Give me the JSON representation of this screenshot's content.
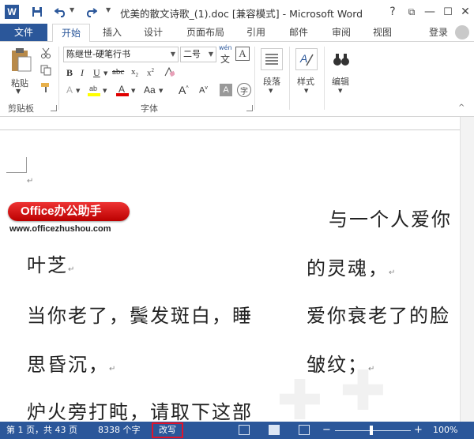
{
  "titlebar": {
    "app_logo": "W",
    "title": "优美的散文诗歌_(1).doc [兼容模式] - Microsoft Word",
    "help": "?",
    "restore": "⧉",
    "minimize": "—",
    "maximize": "☐",
    "close": "✕"
  },
  "tabs": {
    "file": "文件",
    "items": [
      "开始",
      "插入",
      "设计",
      "页面布局",
      "引用",
      "邮件",
      "审阅",
      "视图"
    ],
    "active_index": 0,
    "login": "登录"
  },
  "ribbon": {
    "clipboard": {
      "paste": "粘贴",
      "group": "剪贴板"
    },
    "font": {
      "family": "陈继世-硬笔行书",
      "size": "二号",
      "wen_label": "wén",
      "wen_char": "文",
      "group": "字体"
    },
    "paragraph": {
      "label": "段落"
    },
    "styles": {
      "label": "样式"
    },
    "editing": {
      "label": "编辑"
    }
  },
  "document": {
    "left_column": [
      "叶芝",
      "当你老了，鬓发斑白，睡",
      "思昏沉，",
      "炉火旁打盹，请取下这部"
    ],
    "right_column": [
      "与一个人爱你",
      "的灵魂，",
      "爱你衰老了的脸",
      "皱纹；"
    ],
    "paragraph_mark": "↵",
    "watermark_brand": "Office办公助手",
    "watermark_url": "www.officezhushou.com"
  },
  "statusbar": {
    "page": "第 1 页，共 43 页",
    "words": "8338 个字",
    "overtype": "改写",
    "zoom_minus": "−",
    "zoom_plus": "+",
    "zoom": "100%"
  },
  "colors": {
    "word_blue": "#2b579a",
    "overtype_highlight": "#e0142c",
    "watermark_red": "#cc1111"
  }
}
